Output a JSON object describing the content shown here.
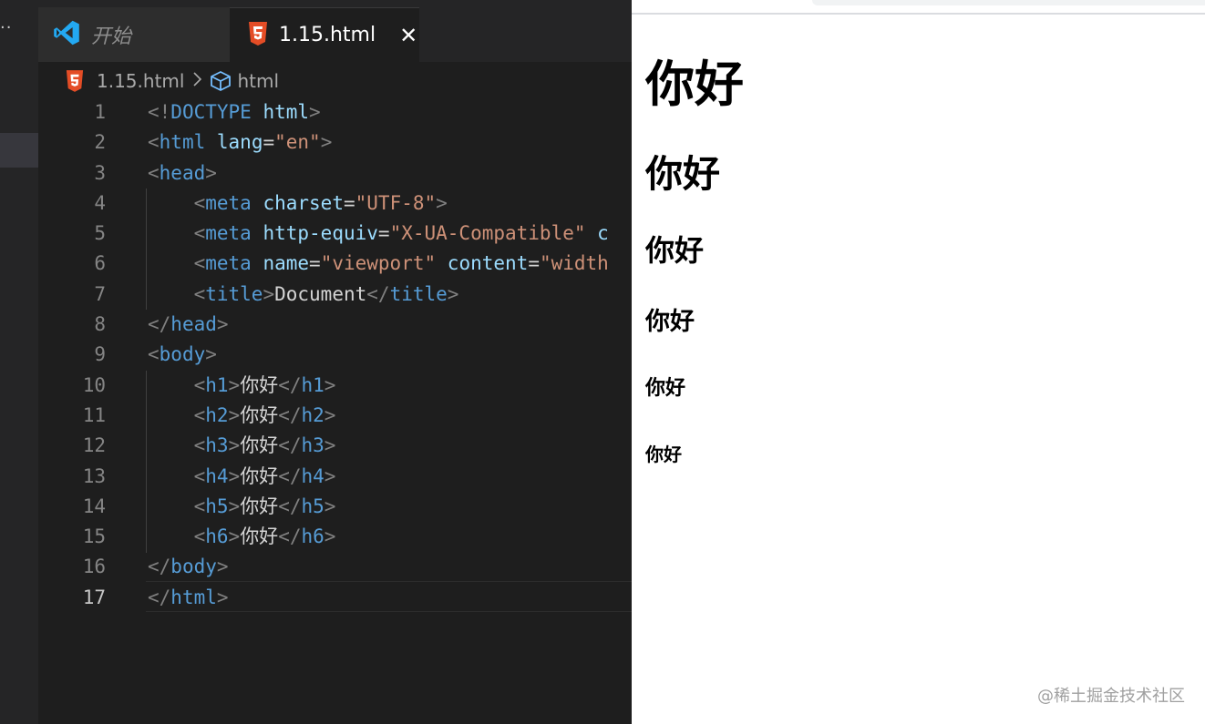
{
  "editor": {
    "tabs": [
      {
        "label": "开始",
        "icon": "vscode-logo-icon",
        "active": false
      },
      {
        "label": "1.15.html",
        "icon": "html5-icon",
        "active": true
      }
    ],
    "breadcrumb": {
      "file": "1.15.html",
      "symbol": "html"
    },
    "active_line": 17,
    "lines": [
      {
        "n": "1",
        "tokens": [
          [
            "p",
            "<!"
          ],
          [
            "t",
            "DOCTYPE"
          ],
          [
            "x",
            " "
          ],
          [
            "a",
            "html"
          ],
          [
            "p",
            ">"
          ]
        ]
      },
      {
        "n": "2",
        "tokens": [
          [
            "p",
            "<"
          ],
          [
            "t",
            "html"
          ],
          [
            "x",
            " "
          ],
          [
            "a",
            "lang"
          ],
          [
            "x",
            "="
          ],
          [
            "s",
            "\"en\""
          ],
          [
            "p",
            ">"
          ]
        ]
      },
      {
        "n": "3",
        "tokens": [
          [
            "p",
            "<"
          ],
          [
            "t",
            "head"
          ],
          [
            "p",
            ">"
          ]
        ]
      },
      {
        "n": "4",
        "tokens": [
          [
            "x",
            "    "
          ],
          [
            "p",
            "<"
          ],
          [
            "t",
            "meta"
          ],
          [
            "x",
            " "
          ],
          [
            "a",
            "charset"
          ],
          [
            "x",
            "="
          ],
          [
            "s",
            "\"UTF-8\""
          ],
          [
            "p",
            ">"
          ]
        ]
      },
      {
        "n": "5",
        "tokens": [
          [
            "x",
            "    "
          ],
          [
            "p",
            "<"
          ],
          [
            "t",
            "meta"
          ],
          [
            "x",
            " "
          ],
          [
            "a",
            "http-equiv"
          ],
          [
            "x",
            "="
          ],
          [
            "s",
            "\"X-UA-Compatible\""
          ],
          [
            "x",
            " "
          ],
          [
            "a",
            "c"
          ]
        ]
      },
      {
        "n": "6",
        "tokens": [
          [
            "x",
            "    "
          ],
          [
            "p",
            "<"
          ],
          [
            "t",
            "meta"
          ],
          [
            "x",
            " "
          ],
          [
            "a",
            "name"
          ],
          [
            "x",
            "="
          ],
          [
            "s",
            "\"viewport\""
          ],
          [
            "x",
            " "
          ],
          [
            "a",
            "content"
          ],
          [
            "x",
            "="
          ],
          [
            "s",
            "\"width"
          ]
        ]
      },
      {
        "n": "7",
        "tokens": [
          [
            "x",
            "    "
          ],
          [
            "p",
            "<"
          ],
          [
            "t",
            "title"
          ],
          [
            "p",
            ">"
          ],
          [
            "x",
            "Document"
          ],
          [
            "p",
            "</"
          ],
          [
            "t",
            "title"
          ],
          [
            "p",
            ">"
          ]
        ]
      },
      {
        "n": "8",
        "tokens": [
          [
            "p",
            "</"
          ],
          [
            "t",
            "head"
          ],
          [
            "p",
            ">"
          ]
        ]
      },
      {
        "n": "9",
        "tokens": [
          [
            "p",
            "<"
          ],
          [
            "t",
            "body"
          ],
          [
            "p",
            ">"
          ]
        ]
      },
      {
        "n": "10",
        "tokens": [
          [
            "x",
            "    "
          ],
          [
            "p",
            "<"
          ],
          [
            "t",
            "h1"
          ],
          [
            "p",
            ">"
          ],
          [
            "x",
            "你好"
          ],
          [
            "p",
            "</"
          ],
          [
            "t",
            "h1"
          ],
          [
            "p",
            ">"
          ]
        ]
      },
      {
        "n": "11",
        "tokens": [
          [
            "x",
            "    "
          ],
          [
            "p",
            "<"
          ],
          [
            "t",
            "h2"
          ],
          [
            "p",
            ">"
          ],
          [
            "x",
            "你好"
          ],
          [
            "p",
            "</"
          ],
          [
            "t",
            "h2"
          ],
          [
            "p",
            ">"
          ]
        ]
      },
      {
        "n": "12",
        "tokens": [
          [
            "x",
            "    "
          ],
          [
            "p",
            "<"
          ],
          [
            "t",
            "h3"
          ],
          [
            "p",
            ">"
          ],
          [
            "x",
            "你好"
          ],
          [
            "p",
            "</"
          ],
          [
            "t",
            "h3"
          ],
          [
            "p",
            ">"
          ]
        ]
      },
      {
        "n": "13",
        "tokens": [
          [
            "x",
            "    "
          ],
          [
            "p",
            "<"
          ],
          [
            "t",
            "h4"
          ],
          [
            "p",
            ">"
          ],
          [
            "x",
            "你好"
          ],
          [
            "p",
            "</"
          ],
          [
            "t",
            "h4"
          ],
          [
            "p",
            ">"
          ]
        ]
      },
      {
        "n": "14",
        "tokens": [
          [
            "x",
            "    "
          ],
          [
            "p",
            "<"
          ],
          [
            "t",
            "h5"
          ],
          [
            "p",
            ">"
          ],
          [
            "x",
            "你好"
          ],
          [
            "p",
            "</"
          ],
          [
            "t",
            "h5"
          ],
          [
            "p",
            ">"
          ]
        ]
      },
      {
        "n": "15",
        "tokens": [
          [
            "x",
            "    "
          ],
          [
            "p",
            "<"
          ],
          [
            "t",
            "h6"
          ],
          [
            "p",
            ">"
          ],
          [
            "x",
            "你好"
          ],
          [
            "p",
            "</"
          ],
          [
            "t",
            "h6"
          ],
          [
            "p",
            ">"
          ]
        ]
      },
      {
        "n": "16",
        "tokens": [
          [
            "p",
            "</"
          ],
          [
            "t",
            "body"
          ],
          [
            "p",
            ">"
          ]
        ]
      },
      {
        "n": "17",
        "tokens": [
          [
            "p",
            "</"
          ],
          [
            "t",
            "html"
          ],
          [
            "p",
            ">"
          ]
        ]
      }
    ]
  },
  "browser": {
    "headings": {
      "h1": "你好",
      "h2": "你好",
      "h3": "你好",
      "h4": "你好",
      "h5": "你好",
      "h6": "你好"
    }
  },
  "watermark": "@稀土掘金技术社区",
  "colors": {
    "editor_bg": "#1e1e1e",
    "tag": "#569cd6",
    "attribute": "#9cdcfe",
    "string": "#ce9178",
    "punctuation": "#808080",
    "html5_orange": "#e44d26",
    "vscode_blue": "#23a9f2"
  }
}
